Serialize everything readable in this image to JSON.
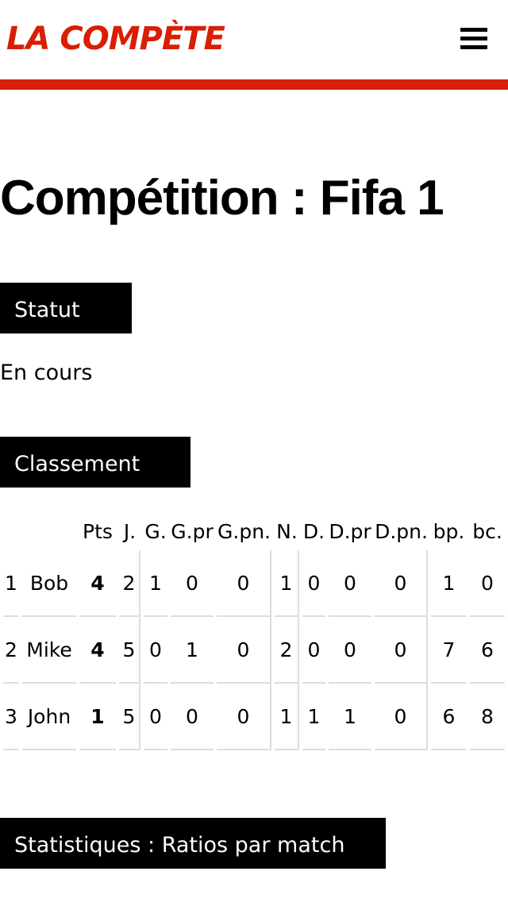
{
  "header": {
    "logo": "LA COMPÈTE",
    "menu_icon": "hamburger-menu-icon"
  },
  "colors": {
    "brand": "#d81e05",
    "label_bg": "#000000",
    "label_text": "#ffffff",
    "grid": "#dddddd"
  },
  "page": {
    "title": "Compétition : Fifa 1"
  },
  "status": {
    "label": "Statut",
    "value": "En cours"
  },
  "ranking": {
    "label": "Classement",
    "columns": [
      "",
      "",
      "Pts",
      "J.",
      "G.",
      "G.pr",
      "G.pn.",
      "N.",
      "D.",
      "D.pr",
      "D.pn.",
      "bp.",
      "bc."
    ],
    "rows": [
      [
        "1",
        "Bob",
        "4",
        "2",
        "1",
        "0",
        "0",
        "1",
        "0",
        "0",
        "0",
        "1",
        "0"
      ],
      [
        "2",
        "Mike",
        "4",
        "5",
        "0",
        "1",
        "0",
        "2",
        "0",
        "0",
        "0",
        "7",
        "6"
      ],
      [
        "3",
        "John",
        "1",
        "5",
        "0",
        "0",
        "0",
        "1",
        "1",
        "1",
        "0",
        "6",
        "8"
      ]
    ]
  },
  "statistics": {
    "label": "Statistiques : Ratios par match"
  }
}
